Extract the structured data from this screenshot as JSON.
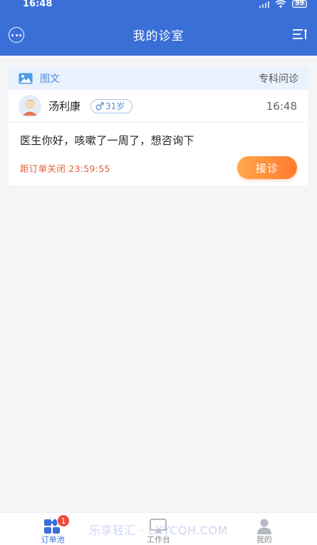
{
  "status_bar": {
    "time": "16:48",
    "battery": "99"
  },
  "header": {
    "title": "我的诊室"
  },
  "order": {
    "type_label": "图文",
    "category": "专科问诊",
    "patient_name": "汤利康",
    "age": "31岁",
    "time": "16:48",
    "message": "医生你好，咳嗽了一周了，想咨询下",
    "countdown": "距订单关闭 23:59:55",
    "accept_label": "接诊"
  },
  "tabs": [
    {
      "label": "订单池",
      "badge": "1",
      "active": true,
      "icon": "grid-icon"
    },
    {
      "label": "工作台",
      "icon": "monitor-icon"
    },
    {
      "label": "我的",
      "icon": "user-icon"
    }
  ],
  "watermark": "乐享轻汇 · LXYCQH.COM",
  "colors": {
    "primary": "#3a6fd8",
    "accent": "#ff7a2e",
    "badge": "#f04a3a"
  }
}
